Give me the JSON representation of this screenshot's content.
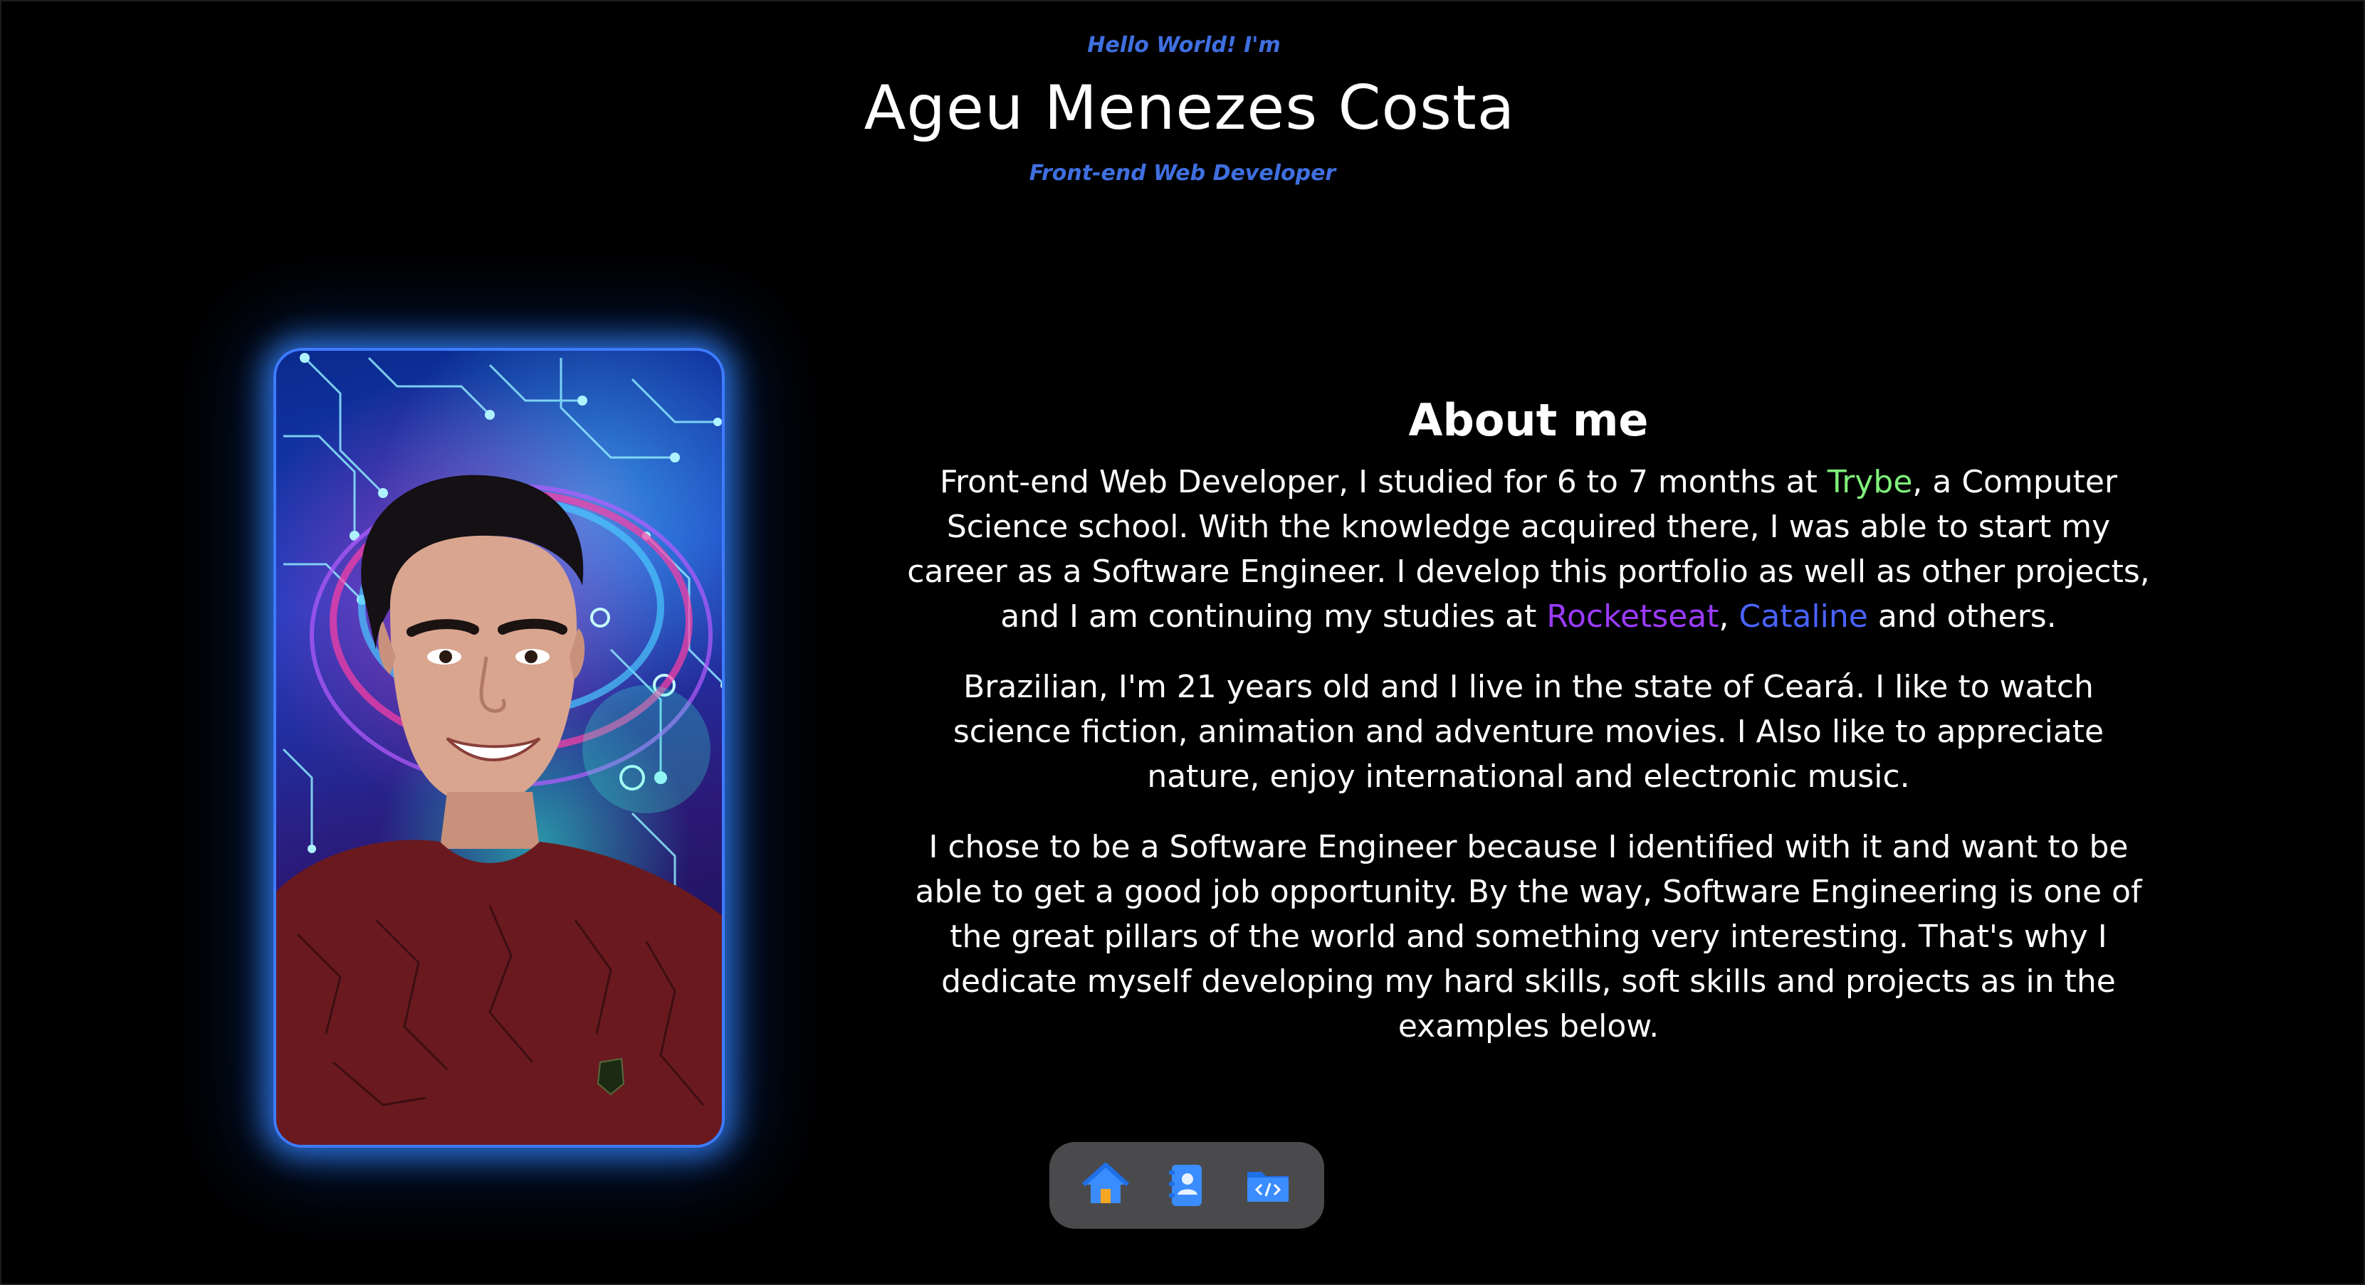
{
  "header": {
    "greeting": "Hello World! I'm",
    "name": "Ageu Menezes Costa",
    "role": "Front-end Web Developer"
  },
  "photo": {
    "description_icon": "profile-photo"
  },
  "about": {
    "title": "About me",
    "p1": {
      "before_trybe": "Front-end Web Developer, I studied for 6 to 7 months at ",
      "trybe": "Trybe",
      "after_trybe": ", a Computer Science school. With the knowledge acquired there, I was able to start my career as a Software Engineer. I develop this portfolio as well as other projects, and I am continuing my studies at ",
      "rocketseat": "Rocketseat",
      "comma": ", ",
      "cataline": "Cataline",
      "after_cataline": " and others."
    },
    "p2": "Brazilian, I'm 21 years old and I live in the state of Ceará. I like to watch science fiction, animation and adventure movies. I Also like to appreciate nature, enjoy international and electronic music.",
    "p3": "I chose to be a Software Engineer because I identified with it and want to be able to get a good job opportunity. By the way, Software Engineering is one of the great pillars of the world and something very interesting. That's why I dedicate myself developing my hard skills, soft skills and projects as in the examples below."
  },
  "dock": {
    "items": [
      {
        "icon": "home-icon"
      },
      {
        "icon": "contacts-icon"
      },
      {
        "icon": "code-folder-icon"
      }
    ]
  },
  "colors": {
    "accent_blue": "#3f6fe0",
    "trybe_green": "#7ff07a",
    "rocketseat_purple": "#9b3bff",
    "cataline_blue": "#4a63ff",
    "card_glow": "#3e7bff",
    "dock_bg": "#4a4a4d"
  }
}
